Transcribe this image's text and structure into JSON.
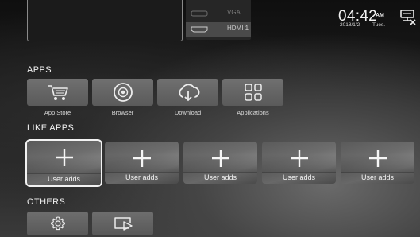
{
  "sources": [
    {
      "label": "VGA"
    },
    {
      "label": "HDMI 1"
    }
  ],
  "status": {
    "time": "04:42",
    "ampm": "AM",
    "date": "2018/1/2",
    "day": "Tues."
  },
  "apps": {
    "title": "APPS",
    "items": [
      {
        "label": "App Store",
        "icon": "cart-icon"
      },
      {
        "label": "Browser",
        "icon": "browser-icon"
      },
      {
        "label": "Download",
        "icon": "cloud-download-icon"
      },
      {
        "label": "Applications",
        "icon": "app-grid-icon"
      }
    ]
  },
  "like_apps": {
    "title": "LIKE APPS",
    "items": [
      {
        "label": "User adds",
        "focused": true
      },
      {
        "label": "User adds"
      },
      {
        "label": "User adds"
      },
      {
        "label": "User adds"
      },
      {
        "label": "User adds"
      }
    ]
  },
  "others": {
    "title": "OTHERS",
    "items": [
      {
        "icon": "settings-gear-icon"
      },
      {
        "icon": "input-source-icon"
      }
    ]
  },
  "colors": {
    "text": "#f0f0f0",
    "tile": "#666666",
    "focus_border": "#f2f2f2"
  }
}
